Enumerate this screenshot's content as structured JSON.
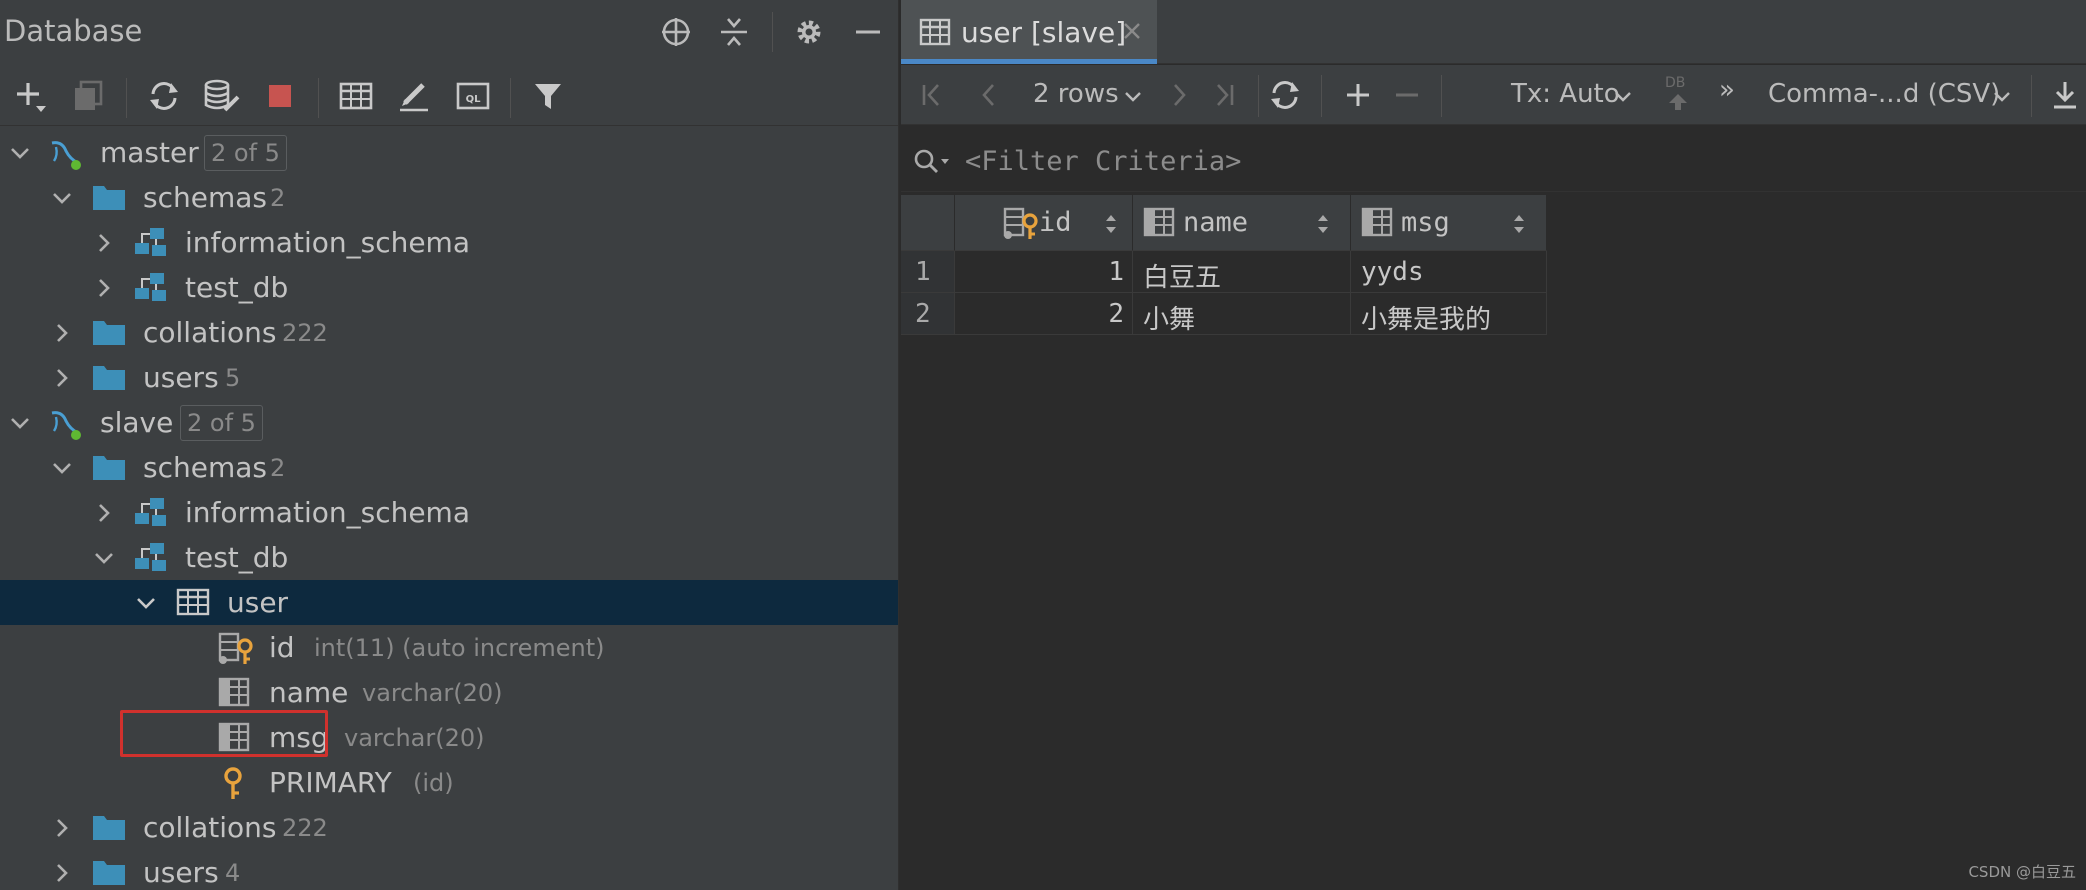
{
  "left_panel": {
    "title": "Database",
    "title_icons": [
      "crosshair-icon",
      "collapse-icon",
      "gear-icon",
      "minimize-icon"
    ],
    "toolbar_icons": [
      "add-icon",
      "copy-icon",
      "refresh-icon",
      "schema-tools-icon",
      "stop-icon",
      "table-icon",
      "edit-icon",
      "sql-console-icon",
      "filter-icon"
    ]
  },
  "tree": {
    "master": {
      "label": "master",
      "badge": "2 of 5"
    },
    "master_schemas": {
      "label": "schemas",
      "count": "2"
    },
    "master_info": {
      "label": "information_schema"
    },
    "master_testdb": {
      "label": "test_db"
    },
    "master_collations": {
      "label": "collations",
      "count": "222"
    },
    "master_users": {
      "label": "users",
      "count": "5"
    },
    "slave": {
      "label": "slave",
      "badge": "2 of 5"
    },
    "slave_schemas": {
      "label": "schemas",
      "count": "2"
    },
    "slave_info": {
      "label": "information_schema"
    },
    "slave_testdb": {
      "label": "test_db"
    },
    "slave_user": {
      "label": "user"
    },
    "col_id": {
      "label": "id",
      "meta": "int(11) (auto increment)"
    },
    "col_name": {
      "label": "name",
      "meta": "varchar(20)"
    },
    "col_msg": {
      "label": "msg",
      "meta": "varchar(20)"
    },
    "key_primary": {
      "label": "PRIMARY",
      "meta": "(id)"
    },
    "slave_collations": {
      "label": "collations",
      "count": "222"
    },
    "slave_users": {
      "label": "users",
      "count": "4"
    }
  },
  "editor": {
    "tab_label": "user [slave]",
    "rows_label": "2 rows",
    "tx_label": "Tx: Auto",
    "db_label": "DB",
    "more_label": "»",
    "export_label": "Comma-...d (CSV)",
    "filter_placeholder": "<Filter Criteria>"
  },
  "grid": {
    "columns": [
      "id",
      "name",
      "msg"
    ],
    "rows": [
      {
        "num": "1",
        "id": "1",
        "name": "白豆五",
        "msg": "yyds"
      },
      {
        "num": "2",
        "id": "2",
        "name": "小舞",
        "msg": "小舞是我的"
      }
    ]
  },
  "watermark": "CSDN @白豆五",
  "colors": {
    "accent": "#4a88c7",
    "folder": "#3a87ad",
    "selection": "#0d293e",
    "highlight_box": "#d0312d",
    "key": "#e8a33d"
  }
}
